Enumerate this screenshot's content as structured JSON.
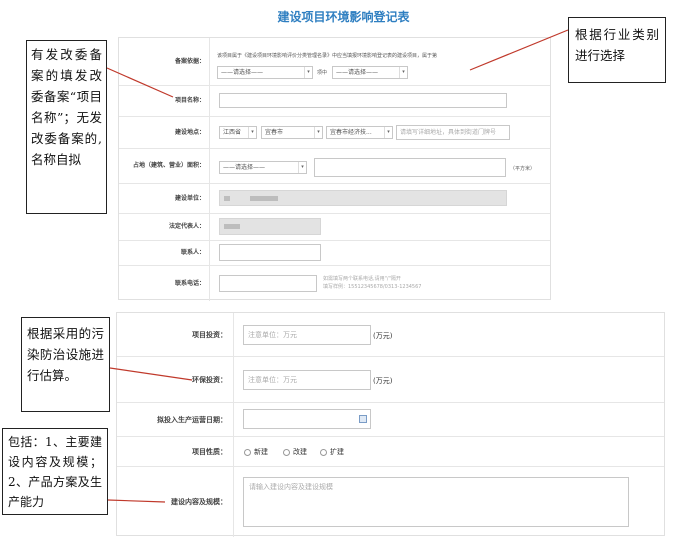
{
  "page_title": "建设项目环境影响登记表",
  "top_form": {
    "filing_basis": {
      "label": "备案依据：",
      "statement": "该项目属于《建设项目环境影响评价分类管理名录》中应当填报环境影响登记表的建设项目，属于第",
      "select1": "——请选择——",
      "middle_text": "项中",
      "select2": "——请选择——"
    },
    "project_name": {
      "label": "项目名称：",
      "value": ""
    },
    "location": {
      "label": "建设地点：",
      "province": "江西省",
      "city": "宜春市",
      "district": "宜春市经济技...",
      "address_placeholder": "请填写详细地址，具体到街道门牌号"
    },
    "area": {
      "label": "占地（建筑、营业）面积：",
      "select": "——请选择——",
      "unit": "（平方米）"
    },
    "construction_unit": {
      "label": "建设单位："
    },
    "legal_rep": {
      "label": "法定代表人："
    },
    "contact": {
      "label": "联系人："
    },
    "phone": {
      "label": "联系电话：",
      "hint1": "如需填写两个联系电话,请用\"/\"隔开",
      "hint2": "填写样例：15512345678/0313-1234567"
    }
  },
  "bottom_form": {
    "investment": {
      "label": "项目投资：",
      "placeholder": "注意单位：万元",
      "unit": "(万元)"
    },
    "env_investment": {
      "label": "环保投资：",
      "placeholder": "注意单位：万元",
      "unit": "(万元)"
    },
    "operation_date": {
      "label": "拟投入生产运营日期："
    },
    "project_nature": {
      "label": "项目性质：",
      "options": [
        "新建",
        "改建",
        "扩建"
      ]
    },
    "content_scale": {
      "label": "建设内容及规模：",
      "placeholder": "请输入建设内容及建设规模"
    }
  },
  "annotations": {
    "left1": "有发改委备案的填发改委备案“项目名称”；无发改委备案的,名称自拟",
    "right1": "根据行业类别进行选择",
    "left2": "根据采用的污染防治设施进行估算。",
    "left3": "包括：1、主要建设内容及规模；2、产品方案及生产能力"
  }
}
